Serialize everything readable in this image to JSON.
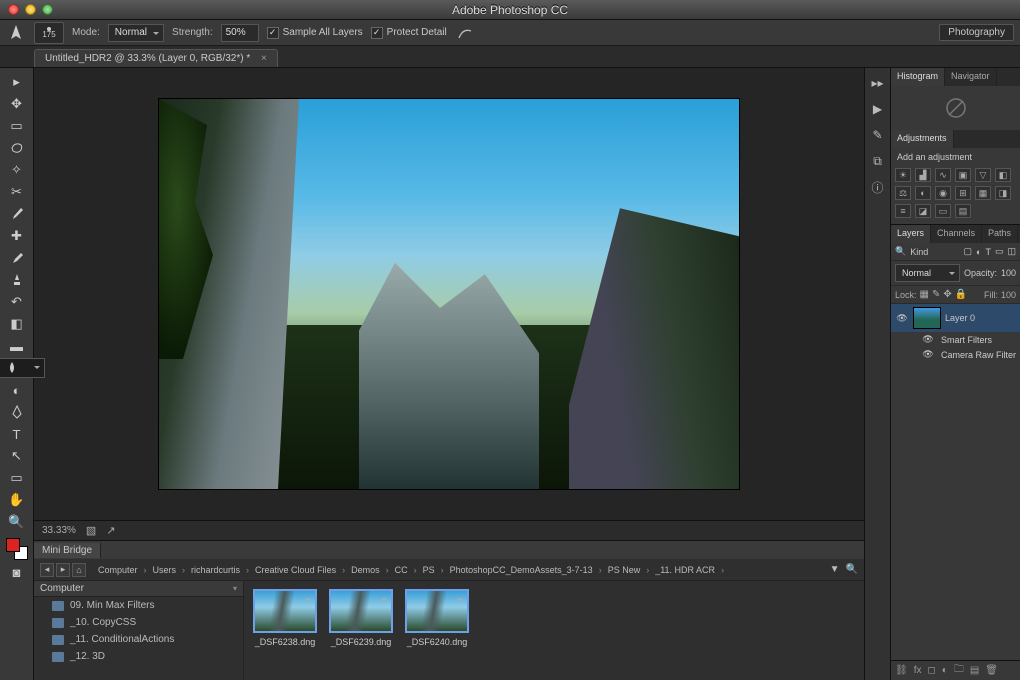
{
  "app": {
    "title": "Adobe Photoshop CC",
    "workspace": "Photography"
  },
  "options": {
    "brush_size": "175",
    "mode_label": "Mode:",
    "mode_value": "Normal",
    "strength_label": "Strength:",
    "strength_value": "50%",
    "sample_all": "Sample All Layers",
    "protect_detail": "Protect Detail"
  },
  "doc": {
    "tab": "Untitled_HDR2 @ 33.3% (Layer 0, RGB/32*) *"
  },
  "status": {
    "zoom": "33.33%"
  },
  "minibridge": {
    "tab": "Mini Bridge",
    "side_header": "Computer",
    "crumbs": [
      "Computer",
      "Users",
      "richardcurtis",
      "Creative Cloud Files",
      "Demos",
      "CC",
      "PS",
      "PhotoshopCC_DemoAssets_3-7-13",
      "PS New",
      "_11. HDR ACR"
    ],
    "folders": [
      "09. Min Max Filters",
      "_10. CopyCSS",
      "_11. ConditionalActions",
      "_12. 3D"
    ],
    "thumbs": [
      "_DSF6238.dng",
      "_DSF6239.dng",
      "_DSF6240.dng"
    ]
  },
  "panels": {
    "histogram_tab": "Histogram",
    "navigator_tab": "Navigator",
    "adjustments_tab": "Adjustments",
    "adjustments_hint": "Add an adjustment",
    "layers_tab": "Layers",
    "channels_tab": "Channels",
    "paths_tab": "Paths",
    "kind_label": "Kind",
    "blend_mode": "Normal",
    "opacity_label": "Opacity:",
    "opacity_value": "100",
    "lock_label": "Lock:",
    "fill_label": "Fill:",
    "fill_value": "100",
    "layer0": "Layer 0",
    "smart_filters": "Smart Filters",
    "camera_raw": "Camera Raw Filter"
  }
}
